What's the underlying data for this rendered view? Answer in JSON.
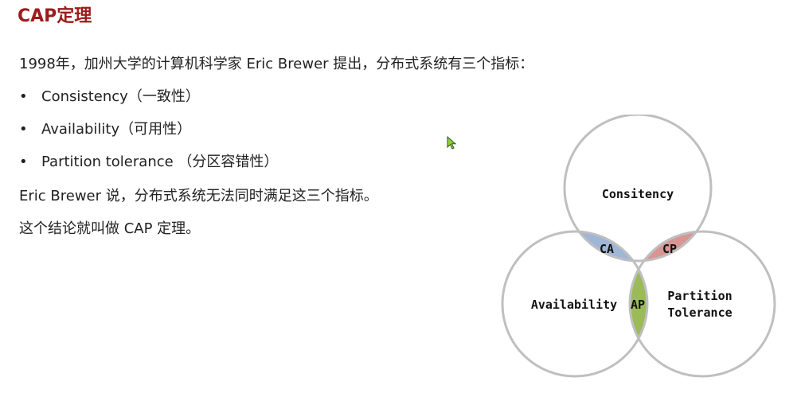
{
  "title": "CAP定理",
  "intro": "1998年，加州大学的计算机科学家 Eric Brewer 提出，分布式系统有三个指标：",
  "bullets": [
    {
      "marker": "•",
      "text": "Consistency（一致性）"
    },
    {
      "marker": "•",
      "text": "Availability（可用性）"
    },
    {
      "marker": "•",
      "text": "Partition tolerance （分区容错性）"
    }
  ],
  "statement": "Eric Brewer 说，分布式系统无法同时满足这三个指标。",
  "conclusion": "这个结论就叫做 CAP 定理。",
  "diagram": {
    "circles": {
      "top": "Consitency",
      "left": "Availability",
      "right_line1": "Partition",
      "right_line2": "Tolerance"
    },
    "intersections": {
      "ca": "CA",
      "cp": "CP",
      "ap": "AP"
    },
    "colors": {
      "ca": "#9fb6d6",
      "cp": "#d99594",
      "ap": "#9bbb59",
      "circle_stroke": "#bfbfbf"
    }
  },
  "colors": {
    "title": "#9b1c1c",
    "text": "#222222"
  }
}
